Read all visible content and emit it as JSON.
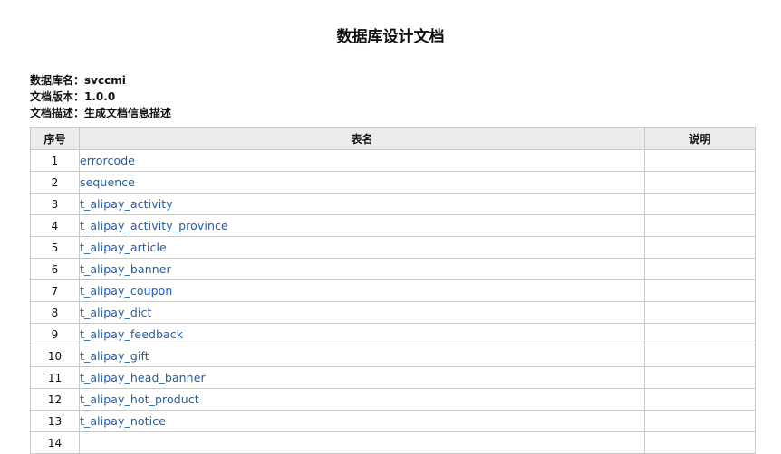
{
  "document": {
    "title": "数据库设计文档",
    "meta": [
      {
        "label": "数据库名：",
        "value": "svccmi"
      },
      {
        "label": "文档版本：",
        "value": "1.0.0"
      },
      {
        "label": "文档描述：",
        "value": "生成文档信息描述"
      }
    ]
  },
  "table": {
    "headers": {
      "no": "序号",
      "name": "表名",
      "desc": "说明"
    },
    "rows": [
      {
        "no": "1",
        "name": "errorcode",
        "desc": ""
      },
      {
        "no": "2",
        "name": "sequence",
        "desc": ""
      },
      {
        "no": "3",
        "name": "t_alipay_activity",
        "desc": ""
      },
      {
        "no": "4",
        "name": "t_alipay_activity_province",
        "desc": ""
      },
      {
        "no": "5",
        "name": "t_alipay_article",
        "desc": ""
      },
      {
        "no": "6",
        "name": "t_alipay_banner",
        "desc": ""
      },
      {
        "no": "7",
        "name": "t_alipay_coupon",
        "desc": ""
      },
      {
        "no": "8",
        "name": "t_alipay_dict",
        "desc": ""
      },
      {
        "no": "9",
        "name": "t_alipay_feedback",
        "desc": ""
      },
      {
        "no": "10",
        "name": "t_alipay_gift",
        "desc": ""
      },
      {
        "no": "11",
        "name": "t_alipay_head_banner",
        "desc": ""
      },
      {
        "no": "12",
        "name": "t_alipay_hot_product",
        "desc": ""
      },
      {
        "no": "13",
        "name": "t_alipay_notice",
        "desc": ""
      },
      {
        "no": "14",
        "name": "",
        "desc": ""
      }
    ]
  },
  "colors": {
    "link": "#1f5fa6",
    "header_bg": "#ececec",
    "border": "#c9c9c9"
  }
}
